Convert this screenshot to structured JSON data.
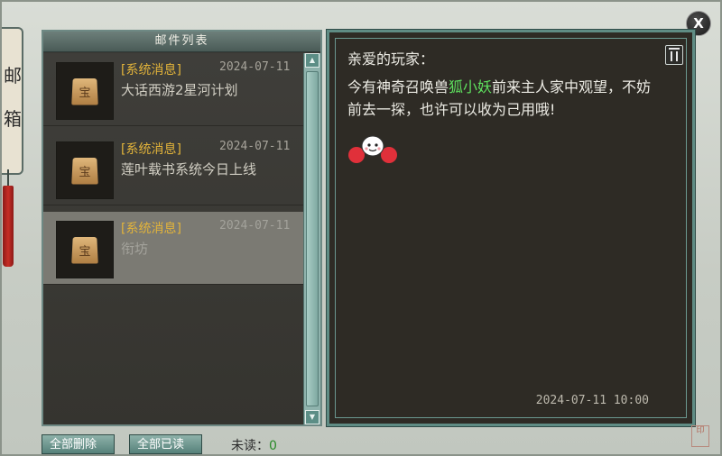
{
  "side_scroll": {
    "chars": [
      "邮",
      "箱"
    ]
  },
  "window": {
    "close_label": "X"
  },
  "mail_list": {
    "title": "邮件列表",
    "items": [
      {
        "tag": "[系统消息]",
        "date": "2024-07-11",
        "subject": "大话西游2星河计划",
        "icon_glyph": "宝"
      },
      {
        "tag": "[系统消息]",
        "date": "2024-07-11",
        "subject": "莲叶载书系统今日上线",
        "icon_glyph": "宝"
      },
      {
        "tag": "[系统消息]",
        "date": "2024-07-11",
        "subject": "衔坊",
        "icon_glyph": "宝"
      }
    ],
    "selected_index": 2
  },
  "message": {
    "greeting": "亲爱的玩家：",
    "text_before": "今有神奇召唤兽",
    "highlight": "狐小妖",
    "text_after": "前来主人家中观望，不妨前去一探，也许可以收为己用哦!",
    "highlight_color": "#5ee05e",
    "timestamp": "2024-07-11 10:00",
    "delete_icon": "trash-icon",
    "emoji_icon": "cheerleader-emoji-icon"
  },
  "footer": {
    "delete_all_label": "全部删除",
    "read_all_label": "全部已读",
    "unread_label": "未读：",
    "unread_count": "0"
  },
  "seal": {
    "text": "印"
  },
  "colors": {
    "accent": "#5f8c84",
    "tag": "#e3b43a",
    "panel_bg": "#2e2b25"
  }
}
